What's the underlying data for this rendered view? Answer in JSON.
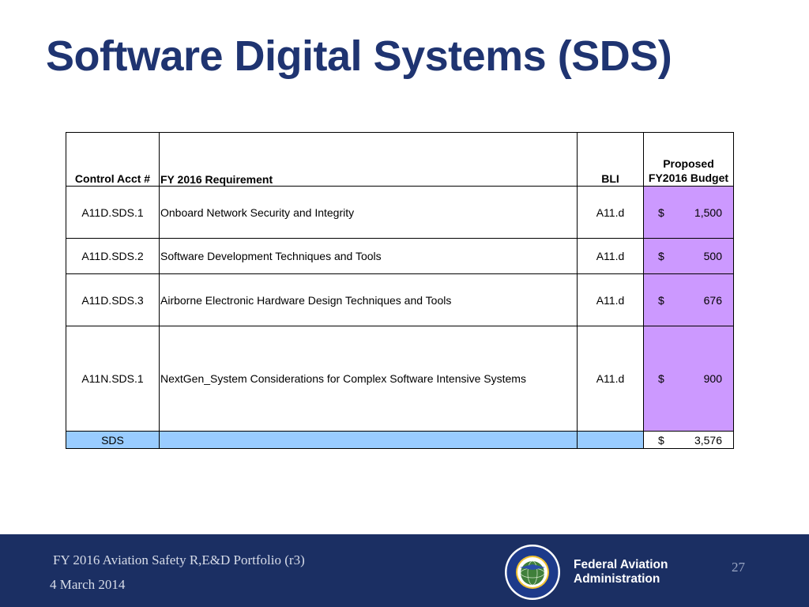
{
  "slide": {
    "title": "Software Digital Systems (SDS)"
  },
  "table": {
    "headers": {
      "control_acct": "Control Acct #",
      "requirement": "FY 2016 Requirement",
      "bli": "BLI",
      "budget_line1": "Proposed",
      "budget_line2": "FY2016 Budget"
    },
    "rows": [
      {
        "acct": "A11D.SDS.1",
        "requirement": "Onboard Network Security and Integrity",
        "bli": "A11.d",
        "currency": "$",
        "amount": "1,500"
      },
      {
        "acct": "A11D.SDS.2",
        "requirement": "Software Development Techniques and Tools",
        "bli": "A11.d",
        "currency": "$",
        "amount": "500"
      },
      {
        "acct": "A11D.SDS.3",
        "requirement": "Airborne Electronic Hardware Design Techniques and Tools",
        "bli": "A11.d",
        "currency": "$",
        "amount": "676"
      },
      {
        "acct": "A11N.SDS.1",
        "requirement": "NextGen_System Considerations for Complex Software Intensive Systems",
        "bli": "A11.d",
        "currency": "$",
        "amount": "900"
      }
    ],
    "total": {
      "label": "SDS",
      "currency": "$",
      "amount": "3,576"
    }
  },
  "footer": {
    "portfolio": "FY 2016 Aviation Safety R,E&D Portfolio (r3)",
    "date": "4 March 2014",
    "agency_line1": "Federal Aviation",
    "agency_line2": "Administration",
    "page_number": "27",
    "seal_icon": "faa-seal-icon",
    "colors": {
      "band": "#1b2f63",
      "title": "#1f3471",
      "budget_cell": "#cc99ff",
      "total_row": "#99ccff"
    }
  }
}
